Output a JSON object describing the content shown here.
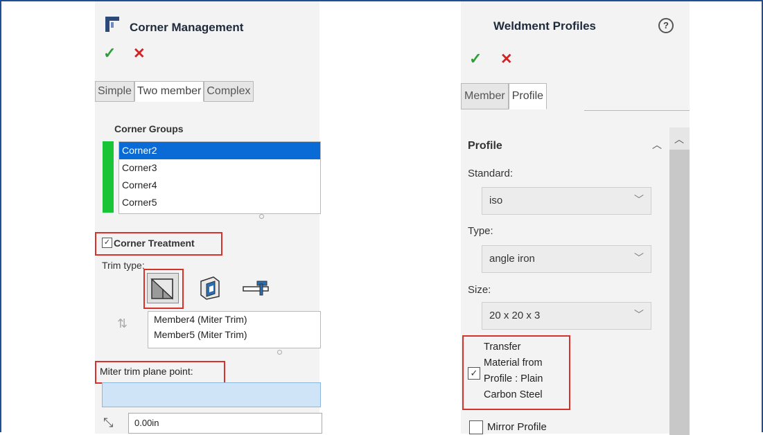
{
  "left": {
    "title": "Corner Management",
    "tabs": [
      "Simple",
      "Two member",
      "Complex"
    ],
    "corner_groups_label": "Corner Groups",
    "corner_groups": [
      "Corner2",
      "Corner3",
      "Corner4",
      "Corner5"
    ],
    "corner_treatment_label": "Corner Treatment",
    "trim_type_label": "Trim type:",
    "members": [
      "Member4 (Miter Trim)",
      "Member5 (Miter Trim)"
    ],
    "miter_label": "Miter trim plane point:",
    "distance_value": "0.00in",
    "colors": {
      "green_bar": "#19c436",
      "selection": "#0a6bd6",
      "highlight_box": "#d9302a"
    }
  },
  "right": {
    "title": "Weldment Profiles",
    "help": "?",
    "tabs": [
      "Member",
      "Profile"
    ],
    "section_title": "Profile",
    "standard_label": "Standard:",
    "standard_value": "iso",
    "type_label": "Type:",
    "type_value": "angle iron",
    "size_label": "Size:",
    "size_value": "20 x 20 x 3",
    "transfer_lines": [
      "Transfer",
      "Material from",
      "Profile : Plain",
      "Carbon Steel"
    ],
    "mirror_label": "Mirror Profile"
  },
  "icons": {
    "ok": "✓",
    "cancel": "✕",
    "chevron_down": "﹀",
    "collapse": "︿",
    "checkbox_checked": "✓"
  }
}
